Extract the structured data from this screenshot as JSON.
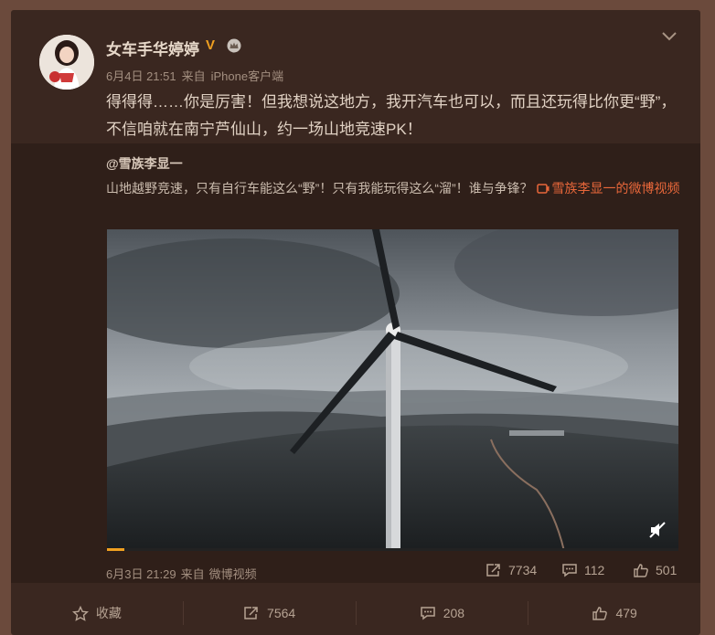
{
  "post": {
    "username": "女车手华婷婷",
    "verified_badge": "V",
    "date": "6月4日 21:51",
    "source_prefix": "来自",
    "source": "iPhone客户端",
    "text": "得得得……你是厉害！但我想说这地方，我开汽车也可以，而且还玩得比你更“野”，不信咱就在南宁芦仙山，约一场山地竞速PK！"
  },
  "repost": {
    "username": "@雪族李显一",
    "text": "山地越野竞速，只有自行车能这么“野”！只有我能玩得这么“溜”！谁与争锋？ ",
    "link": "雪族李显一的微博视频",
    "date": "6月3日 21:29",
    "source_prefix": "来自",
    "source": "微博视频",
    "video_progress": 0.03,
    "stats": {
      "repost": "7734",
      "comment": "112",
      "like": "501"
    }
  },
  "actions": {
    "favorite": "收藏",
    "repost": "7564",
    "comment": "208",
    "like": "479"
  },
  "colors": {
    "accent": "#f0a020",
    "link": "#e8673a"
  }
}
